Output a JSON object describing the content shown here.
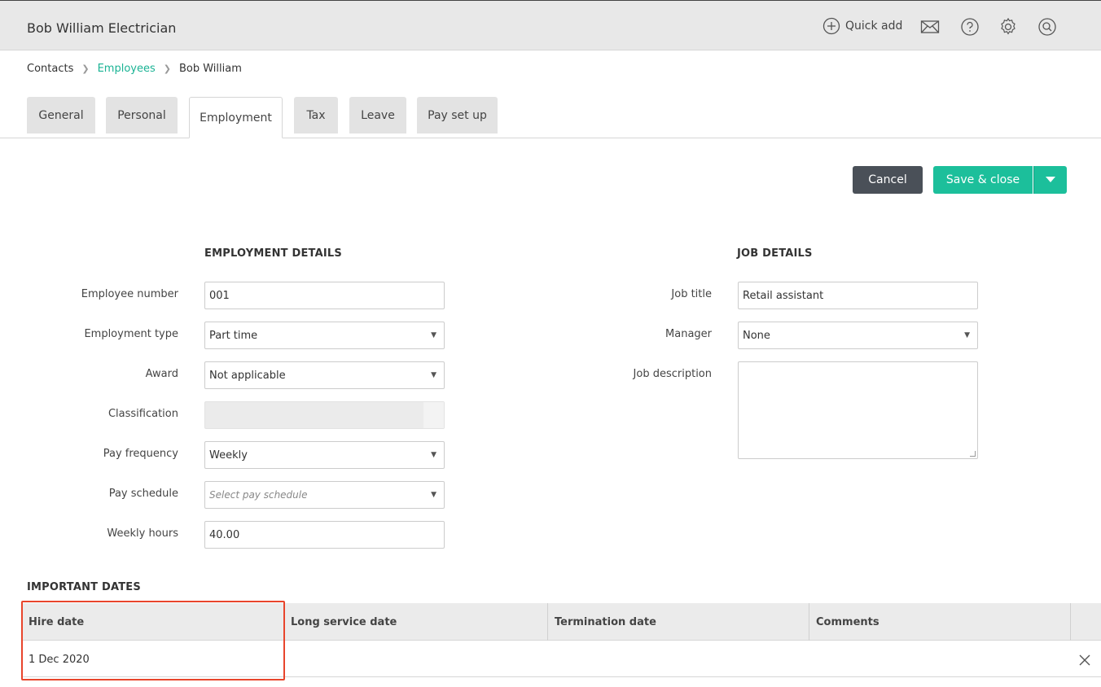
{
  "app": {
    "title": "Bob William Electrician"
  },
  "topbar": {
    "quick_add": "Quick add",
    "icons": [
      "plus-circle-icon",
      "mail-icon",
      "help-icon",
      "settings-icon",
      "search-icon"
    ]
  },
  "breadcrumb": {
    "items": [
      "Contacts",
      "Employees",
      "Bob William"
    ]
  },
  "tabs": [
    "General",
    "Personal",
    "Employment",
    "Tax",
    "Leave",
    "Pay set up"
  ],
  "active_tab": "Employment",
  "actions": {
    "cancel": "Cancel",
    "save": "Save & close"
  },
  "employment": {
    "heading": "EMPLOYMENT DETAILS",
    "employee_number": {
      "label": "Employee number",
      "value": "001"
    },
    "employment_type": {
      "label": "Employment type",
      "value": "Part time"
    },
    "award": {
      "label": "Award",
      "value": "Not applicable"
    },
    "classification": {
      "label": "Classification",
      "value": ""
    },
    "pay_frequency": {
      "label": "Pay frequency",
      "value": "Weekly"
    },
    "pay_schedule": {
      "label": "Pay schedule",
      "placeholder": "Select pay schedule"
    },
    "weekly_hours": {
      "label": "Weekly hours",
      "value": "40.00"
    }
  },
  "job": {
    "heading": "JOB DETAILS",
    "job_title": {
      "label": "Job title",
      "value": "Retail assistant"
    },
    "manager": {
      "label": "Manager",
      "value": "None"
    },
    "job_description": {
      "label": "Job description",
      "value": ""
    }
  },
  "important_dates": {
    "heading": "IMPORTANT DATES",
    "columns": [
      "Hire date",
      "Long service date",
      "Termination date",
      "Comments"
    ],
    "row": {
      "hire_date": "1 Dec 2020",
      "long_service_date": "",
      "termination_date": "",
      "comments": ""
    }
  },
  "colors": {
    "accent": "#1cbf9b",
    "cancel": "#4a5058",
    "highlight": "#e8452c"
  }
}
